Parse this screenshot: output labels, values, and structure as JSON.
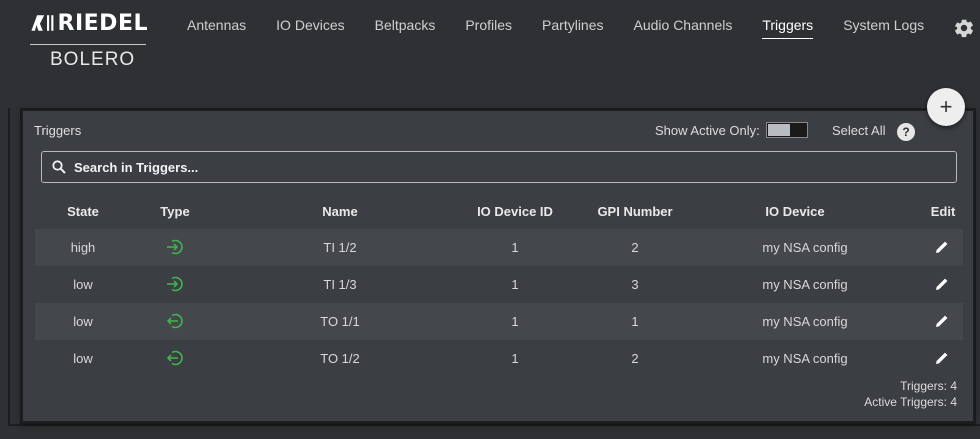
{
  "brand": {
    "name": "RIEDEL",
    "product": "BOLERO"
  },
  "nav": [
    {
      "label": "Antennas",
      "active": false
    },
    {
      "label": "IO Devices",
      "active": false
    },
    {
      "label": "Beltpacks",
      "active": false
    },
    {
      "label": "Profiles",
      "active": false
    },
    {
      "label": "Partylines",
      "active": false
    },
    {
      "label": "Audio Channels",
      "active": false
    },
    {
      "label": "Triggers",
      "active": true
    },
    {
      "label": "System Logs",
      "active": false
    }
  ],
  "panel": {
    "title": "Triggers",
    "show_active_label": "Show Active Only:",
    "select_all_label": "Select All",
    "help_glyph": "?",
    "add_glyph": "+",
    "search_placeholder": "Search in Triggers..."
  },
  "table": {
    "columns": [
      "State",
      "Type",
      "Name",
      "IO Device ID",
      "GPI Number",
      "IO Device",
      "Edit"
    ],
    "rows": [
      {
        "state": "high",
        "type": "input",
        "name": "TI 1/2",
        "io_device_id": "1",
        "gpi_number": "2",
        "io_device": "my NSA config"
      },
      {
        "state": "low",
        "type": "input",
        "name": "TI 1/3",
        "io_device_id": "1",
        "gpi_number": "3",
        "io_device": "my NSA config"
      },
      {
        "state": "low",
        "type": "output",
        "name": "TO 1/1",
        "io_device_id": "1",
        "gpi_number": "1",
        "io_device": "my NSA config"
      },
      {
        "state": "low",
        "type": "output",
        "name": "TO 1/2",
        "io_device_id": "1",
        "gpi_number": "2",
        "io_device": "my NSA config"
      }
    ]
  },
  "counts": {
    "triggers": "Triggers: 4",
    "active": "Active Triggers: 4"
  },
  "colors": {
    "accent_green": "#3fb34f",
    "background": "#2e3033",
    "panel": "#3b3e42"
  }
}
